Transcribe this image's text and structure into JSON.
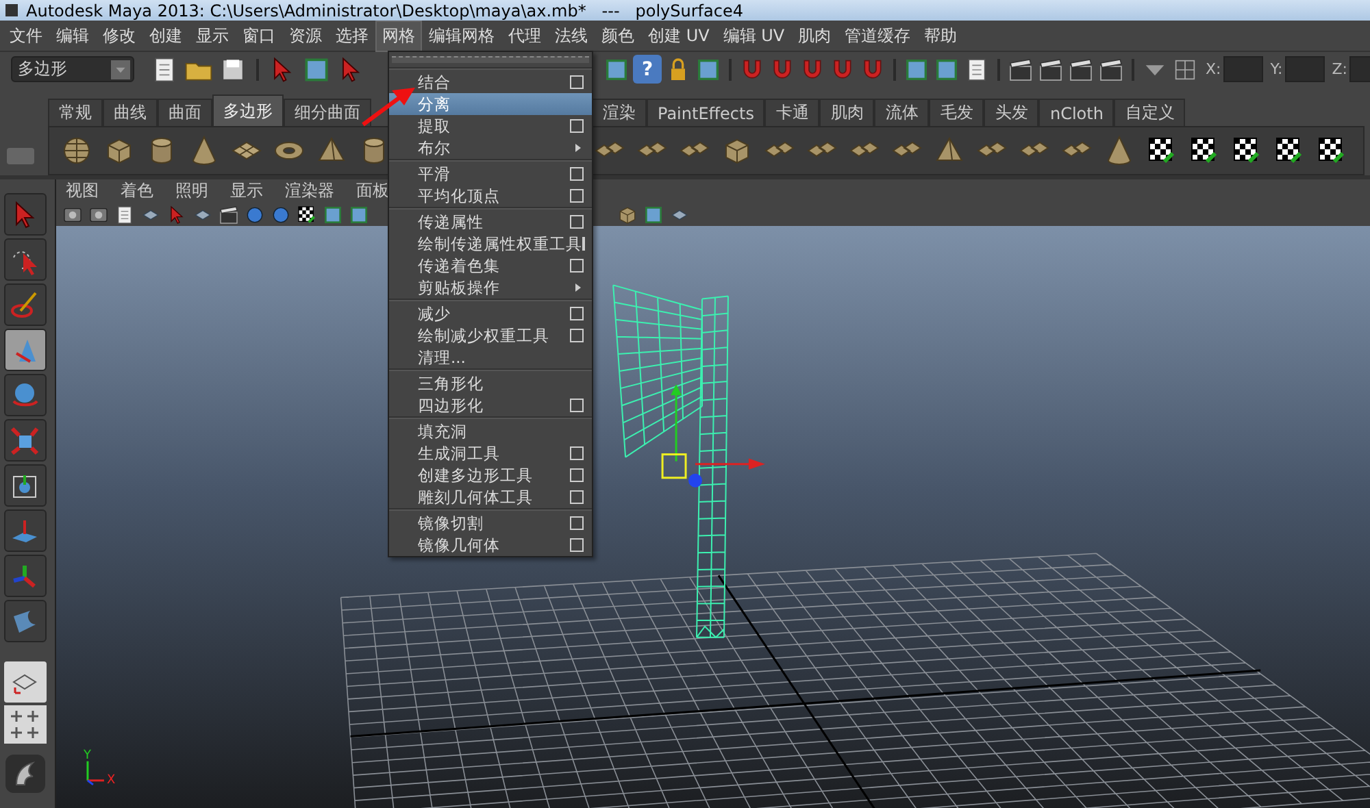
{
  "window": {
    "title": "Autodesk Maya 2013: C:\\Users\\Administrator\\Desktop\\maya\\ax.mb*   ---   polySurface4"
  },
  "menu_bar": [
    {
      "label": "文件",
      "selected": false
    },
    {
      "label": "编辑",
      "selected": false
    },
    {
      "label": "修改",
      "selected": false
    },
    {
      "label": "创建",
      "selected": false
    },
    {
      "label": "显示",
      "selected": false
    },
    {
      "label": "窗口",
      "selected": false
    },
    {
      "label": "资源",
      "selected": false
    },
    {
      "label": "选择",
      "selected": false
    },
    {
      "label": "网格",
      "selected": true
    },
    {
      "label": "编辑网格",
      "selected": false
    },
    {
      "label": "代理",
      "selected": false
    },
    {
      "label": "法线",
      "selected": false
    },
    {
      "label": "颜色",
      "selected": false
    },
    {
      "label": "创建 UV",
      "selected": false
    },
    {
      "label": "编辑 UV",
      "selected": false
    },
    {
      "label": "肌肉",
      "selected": false
    },
    {
      "label": "管道缓存",
      "selected": false
    },
    {
      "label": "帮助",
      "selected": false
    }
  ],
  "toolbar": {
    "mode_dropdown": "多边形",
    "help_glyph": "?",
    "coord_labels": [
      "X:",
      "Y:",
      "Z:"
    ]
  },
  "shelf": {
    "tabs": [
      {
        "label": "常规",
        "selected": false
      },
      {
        "label": "曲线",
        "selected": false
      },
      {
        "label": "曲面",
        "selected": false
      },
      {
        "label": "多边形",
        "selected": true
      },
      {
        "label": "细分曲面",
        "selected": false
      },
      {
        "label": "渲染",
        "selected": false
      },
      {
        "label": "PaintEffects",
        "selected": false
      },
      {
        "label": "卡通",
        "selected": false
      },
      {
        "label": "肌肉",
        "selected": false
      },
      {
        "label": "流体",
        "selected": false
      },
      {
        "label": "毛发",
        "selected": false
      },
      {
        "label": "头发",
        "selected": false
      },
      {
        "label": "nCloth",
        "selected": false
      },
      {
        "label": "自定义",
        "selected": false
      }
    ]
  },
  "toolbox": {
    "tools": [
      {
        "selected": false
      },
      {
        "selected": false
      },
      {
        "selected": false
      },
      {
        "selected": true
      },
      {
        "selected": false
      },
      {
        "selected": false
      },
      {
        "selected": false
      },
      {
        "selected": false
      },
      {
        "selected": false
      },
      {
        "selected": false
      }
    ]
  },
  "viewport": {
    "menu": [
      "视图",
      "着色",
      "照明",
      "显示",
      "渲染器",
      "面板"
    ],
    "axis_labels": [
      "Y",
      "X"
    ]
  },
  "mesh_menu": {
    "groups": [
      [
        {
          "label": "结合",
          "kind": "option",
          "selected": false
        },
        {
          "label": "分离",
          "kind": "plain",
          "selected": true
        },
        {
          "label": "提取",
          "kind": "option",
          "selected": false
        },
        {
          "label": "布尔",
          "kind": "submenu",
          "selected": false
        }
      ],
      [
        {
          "label": "平滑",
          "kind": "option",
          "selected": false
        },
        {
          "label": "平均化顶点",
          "kind": "option",
          "selected": false
        }
      ],
      [
        {
          "label": "传递属性",
          "kind": "option",
          "selected": false
        },
        {
          "label": "绘制传递属性权重工具",
          "kind": "option",
          "selected": false
        },
        {
          "label": "传递着色集",
          "kind": "option",
          "selected": false
        },
        {
          "label": "剪贴板操作",
          "kind": "submenu",
          "selected": false
        }
      ],
      [
        {
          "label": "减少",
          "kind": "option",
          "selected": false
        },
        {
          "label": "绘制减少权重工具",
          "kind": "option",
          "selected": false
        },
        {
          "label": "清理...",
          "kind": "plain",
          "selected": false
        }
      ],
      [
        {
          "label": "三角形化",
          "kind": "plain",
          "selected": false
        },
        {
          "label": "四边形化",
          "kind": "option",
          "selected": false
        }
      ],
      [
        {
          "label": "填充洞",
          "kind": "plain",
          "selected": false
        },
        {
          "label": "生成洞工具",
          "kind": "option",
          "selected": false
        },
        {
          "label": "创建多边形工具",
          "kind": "option",
          "selected": false
        },
        {
          "label": "雕刻几何体工具",
          "kind": "option",
          "selected": false
        }
      ],
      [
        {
          "label": "镜像切割",
          "kind": "option",
          "selected": false
        },
        {
          "label": "镜像几何体",
          "kind": "option",
          "selected": false
        }
      ]
    ]
  }
}
